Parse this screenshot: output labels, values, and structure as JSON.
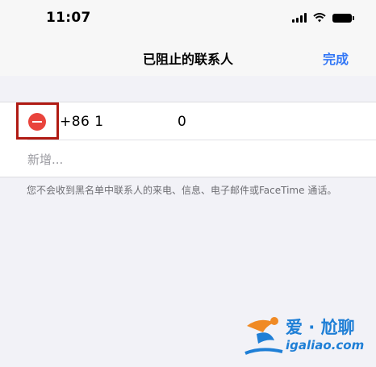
{
  "status_bar": {
    "time": "11:07"
  },
  "nav": {
    "title": "已阻止的联系人",
    "done_label": "完成"
  },
  "blocked_list": {
    "contact_number": "+86 1",
    "contact_number_tail": "0",
    "add_new_label": "新增..."
  },
  "footer": {
    "note": "您不会收到黑名单中联系人的来电、信息、电子邮件或FaceTime 通话。"
  },
  "watermark": {
    "title": "爱 · 尬聊",
    "url": "igaliao.com"
  },
  "colors": {
    "accent": "#3478f6",
    "delete": "#e9443c",
    "highlight": "#b01a13",
    "watermark": "#1f7fd6"
  },
  "icons": [
    "signal-icon",
    "wifi-icon",
    "battery-icon",
    "delete-icon",
    "watermark-logo-icon"
  ]
}
